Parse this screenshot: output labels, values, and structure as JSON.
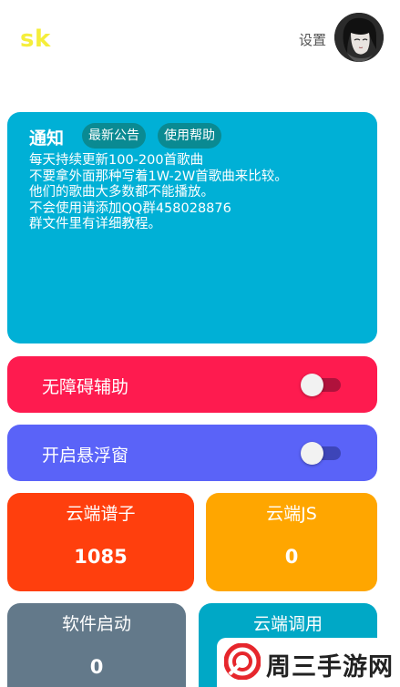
{
  "header": {
    "logo_text": "sk",
    "settings_label": "设置",
    "avatar_icon": "anime-girl-avatar"
  },
  "notice": {
    "title": "通知",
    "chips": [
      "最新公告",
      "使用帮助"
    ],
    "lines": [
      "每天持续更新100-200首歌曲",
      "不要拿外面那种写着1W-2W首歌曲来比较。",
      "他们的歌曲大多数都不能播放。",
      "不会使用请添加QQ群458028876",
      "群文件里有详细教程。"
    ],
    "color": "#00b0d6"
  },
  "toggles": [
    {
      "label": "无障碍辅助",
      "on": false,
      "color": "#fe1b4f"
    },
    {
      "label": "开启悬浮窗",
      "on": false,
      "color": "#5a63f8"
    }
  ],
  "tiles": [
    {
      "label": "云端谱子",
      "value": "1085",
      "color": "#ff3f0d"
    },
    {
      "label": "云端JS",
      "value": "0",
      "color": "#ffa600"
    },
    {
      "label": "软件启动",
      "value": "0",
      "color": "#63798a"
    },
    {
      "label": "云端调用",
      "value": "",
      "color": "#00a8c6"
    }
  ],
  "watermark": {
    "text": "周三手游网",
    "icon": "watermark-logo-icon"
  }
}
